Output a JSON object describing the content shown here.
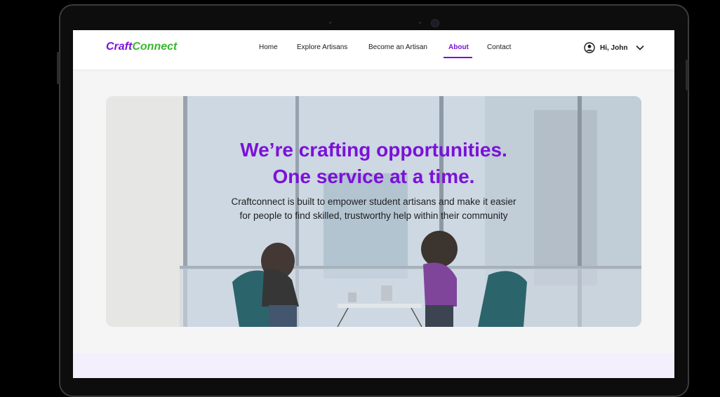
{
  "brand": {
    "part1": "Craft",
    "part2": "Connect",
    "color1": "#7b11d9",
    "color2": "#38b72f"
  },
  "nav": {
    "items": [
      {
        "label": "Home"
      },
      {
        "label": "Explore Artisans"
      },
      {
        "label": "Become an Artisan"
      },
      {
        "label": "About",
        "active": true
      },
      {
        "label": "Contact"
      }
    ]
  },
  "user": {
    "greeting": "Hi, John",
    "icon": "user-circle-icon",
    "dropdown_icon": "chevron-down-icon"
  },
  "hero": {
    "title_line1": "We’re crafting opportunities.",
    "title_line2": "One service at a time.",
    "subtitle_line1": "Craftconnect is built to empower student artisans and make it easier",
    "subtitle_line2": "for people to find skilled, trustworthy help within their community"
  },
  "colors": {
    "accent": "#7b11d9",
    "band": "#f3effc"
  }
}
